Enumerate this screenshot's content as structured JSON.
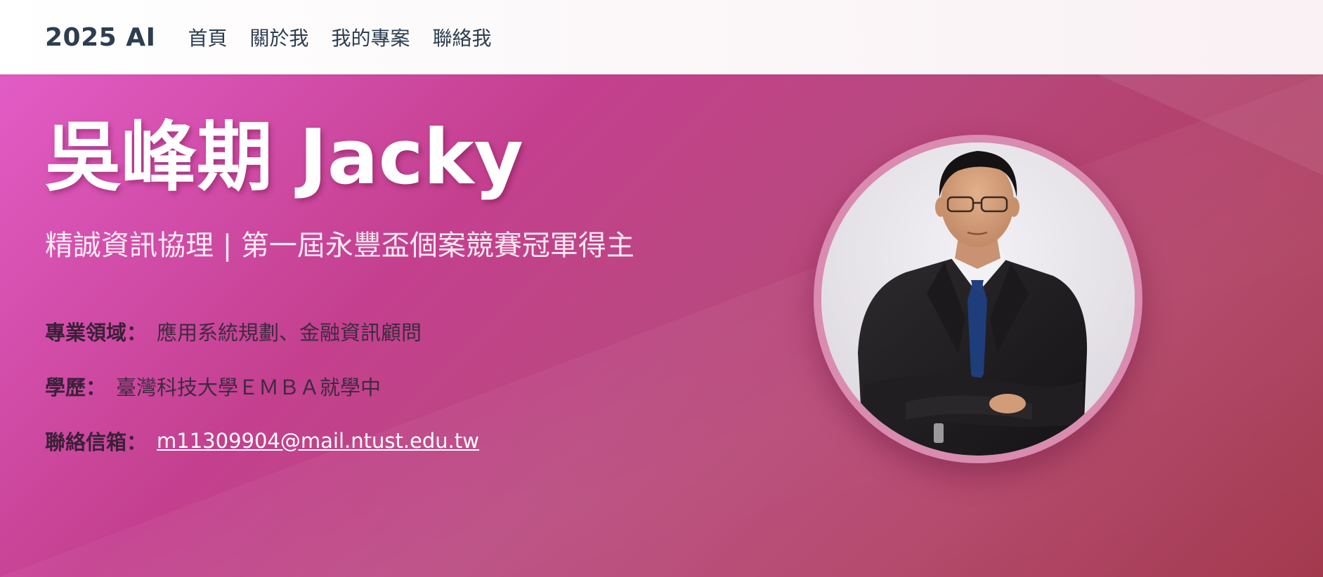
{
  "navbar": {
    "brand": "2025 AI",
    "links": [
      {
        "label": "首頁"
      },
      {
        "label": "關於我"
      },
      {
        "label": "我的專案"
      },
      {
        "label": "聯絡我"
      }
    ]
  },
  "hero": {
    "name": "吳峰期 Jacky",
    "subtitle": "精誠資訊協理 | 第一屆永豐盃個案競賽冠軍得主",
    "info": [
      {
        "label": "專業領域：",
        "value": "應用系統規劃、金融資訊顧問"
      },
      {
        "label": "學歷：",
        "value": "臺灣科技大學ＥＭＢＡ就學中"
      },
      {
        "label": "聯絡信箱：",
        "value": "m11309904@mail.ntust.edu.tw"
      }
    ]
  },
  "colors": {
    "hero_gradient_start": "#e25cc6",
    "hero_gradient_end": "#9d2f44",
    "nav_text": "#2c3e50",
    "portrait_ring": "#d98bb0"
  },
  "icons": {
    "portrait": "person-portrait"
  }
}
